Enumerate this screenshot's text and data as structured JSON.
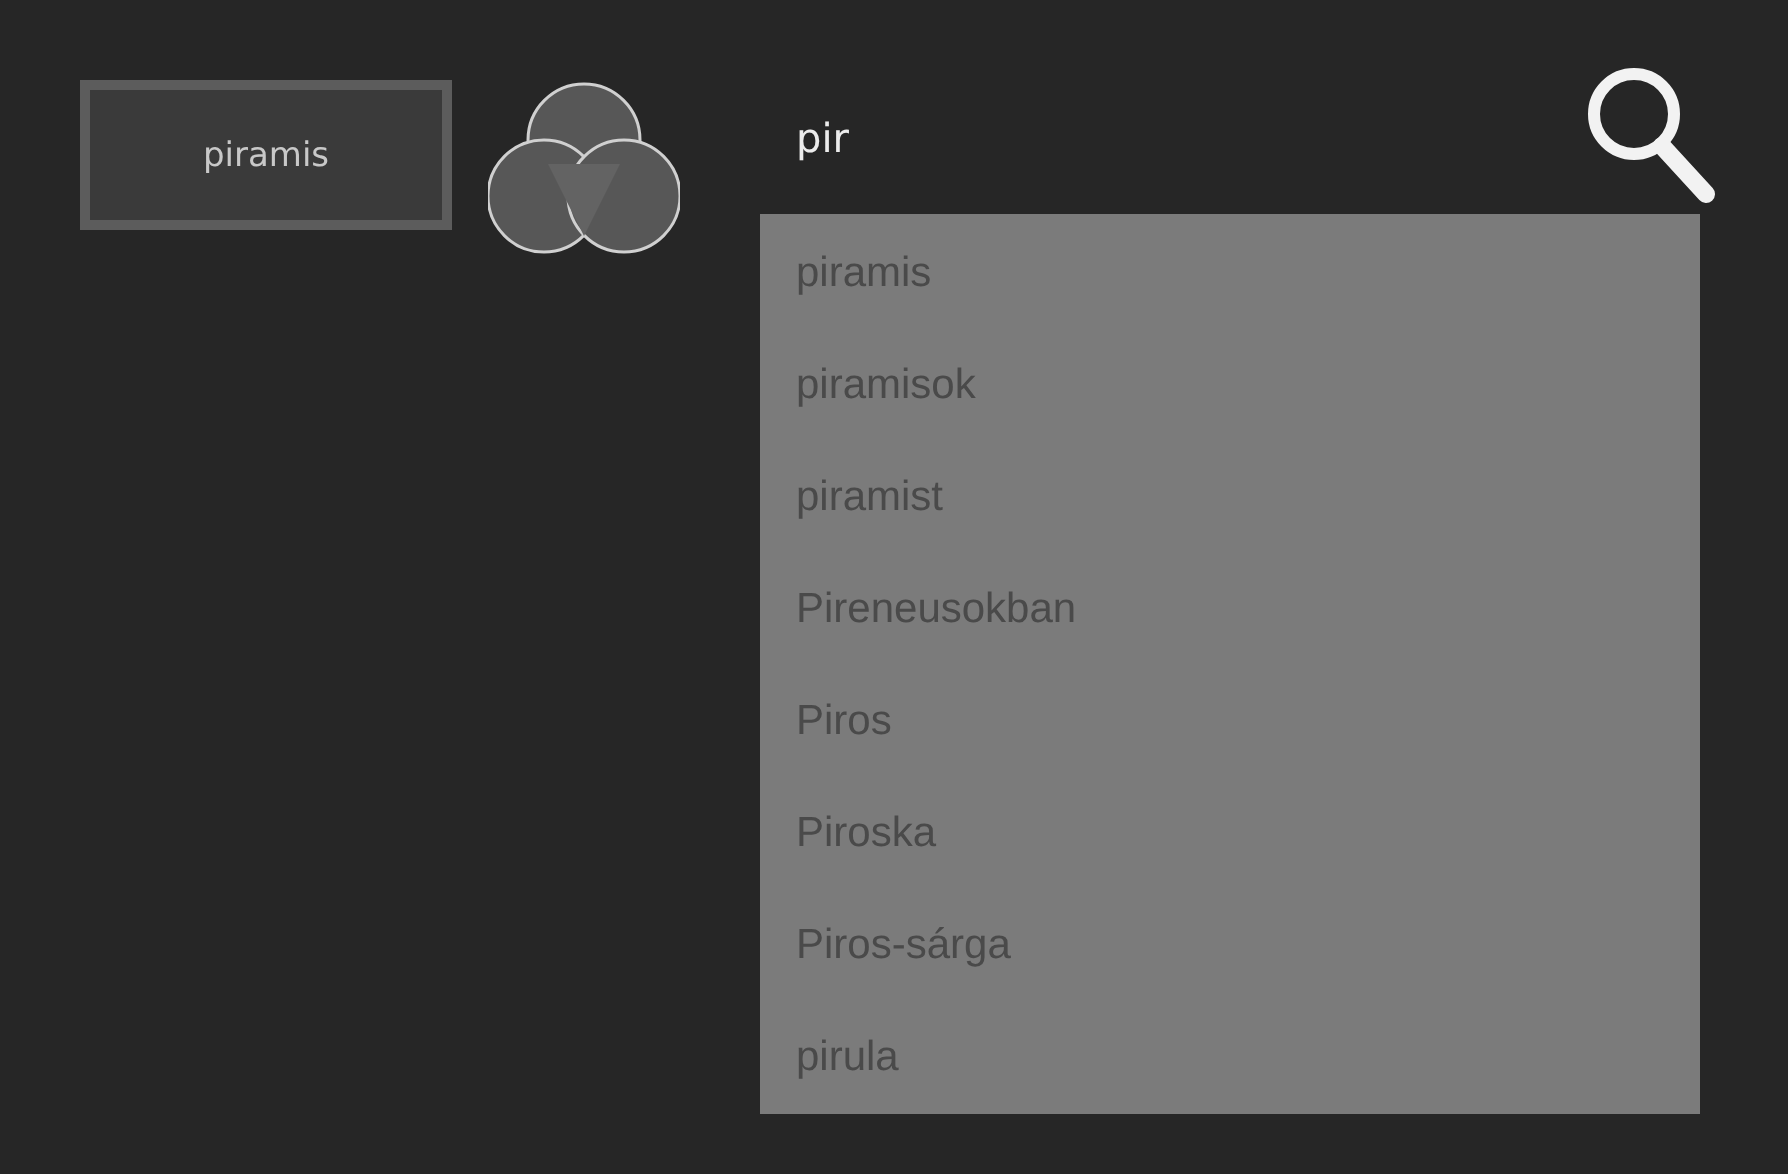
{
  "word_button": {
    "label": "piramis"
  },
  "search": {
    "value": "pir"
  },
  "suggestions": [
    {
      "label": "piramis"
    },
    {
      "label": "piramisok"
    },
    {
      "label": "piramist"
    },
    {
      "label": "Pireneusokban"
    },
    {
      "label": "Piros"
    },
    {
      "label": "Piroska"
    },
    {
      "label": "Piros-sárga"
    },
    {
      "label": "pirula"
    }
  ]
}
